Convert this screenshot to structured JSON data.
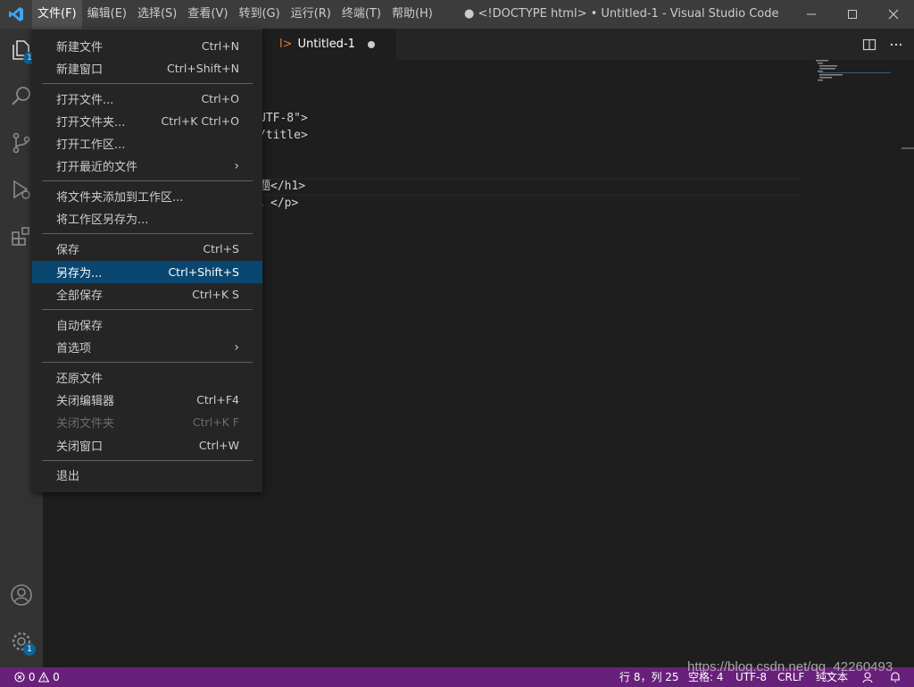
{
  "menubar": {
    "items": [
      "文件(F)",
      "编辑(E)",
      "选择(S)",
      "查看(V)",
      "转到(G)",
      "运行(R)",
      "终端(T)",
      "帮助(H)"
    ]
  },
  "window": {
    "title": "● <!DOCTYPE html> • Untitled-1 - Visual Studio Code"
  },
  "tab": {
    "prefix": "l>",
    "label": "Untitled-1"
  },
  "activitybar": {
    "explorer_badge": "1",
    "settings_badge": "1"
  },
  "code_lines": [
    "UTF-8\">",
    "/title>",
    "题</h1>",
    "。</p>"
  ],
  "file_menu": {
    "new_file": {
      "label": "新建文件",
      "shortcut": "Ctrl+N"
    },
    "new_window": {
      "label": "新建窗口",
      "shortcut": "Ctrl+Shift+N"
    },
    "open_file": {
      "label": "打开文件...",
      "shortcut": "Ctrl+O"
    },
    "open_folder": {
      "label": "打开文件夹...",
      "shortcut": "Ctrl+K Ctrl+O"
    },
    "open_workspace": {
      "label": "打开工作区..."
    },
    "open_recent": {
      "label": "打开最近的文件"
    },
    "add_folder": {
      "label": "将文件夹添加到工作区..."
    },
    "save_workspace_as": {
      "label": "将工作区另存为..."
    },
    "save": {
      "label": "保存",
      "shortcut": "Ctrl+S"
    },
    "save_as": {
      "label": "另存为...",
      "shortcut": "Ctrl+Shift+S"
    },
    "save_all": {
      "label": "全部保存",
      "shortcut": "Ctrl+K S"
    },
    "auto_save": {
      "label": "自动保存"
    },
    "preferences": {
      "label": "首选项"
    },
    "revert_file": {
      "label": "还原文件"
    },
    "close_editor": {
      "label": "关闭编辑器",
      "shortcut": "Ctrl+F4"
    },
    "close_folder": {
      "label": "关闭文件夹",
      "shortcut": "Ctrl+K F"
    },
    "close_window": {
      "label": "关闭窗口",
      "shortcut": "Ctrl+W"
    },
    "exit": {
      "label": "退出"
    }
  },
  "statusbar": {
    "errors": "0",
    "warnings": "0",
    "position": "行 8，列 25",
    "spaces": "空格: 4",
    "encoding": "UTF-8",
    "eol": "CRLF",
    "language": "纯文本"
  },
  "watermark": "https://blog.csdn.net/qq_42260493",
  "colors": {
    "titlebar": "#3c3c3c",
    "activitybar": "#333333",
    "editor": "#1e1e1e",
    "menu": "#252526",
    "menu_selected": "#094771",
    "statusbar": "#68217a"
  }
}
